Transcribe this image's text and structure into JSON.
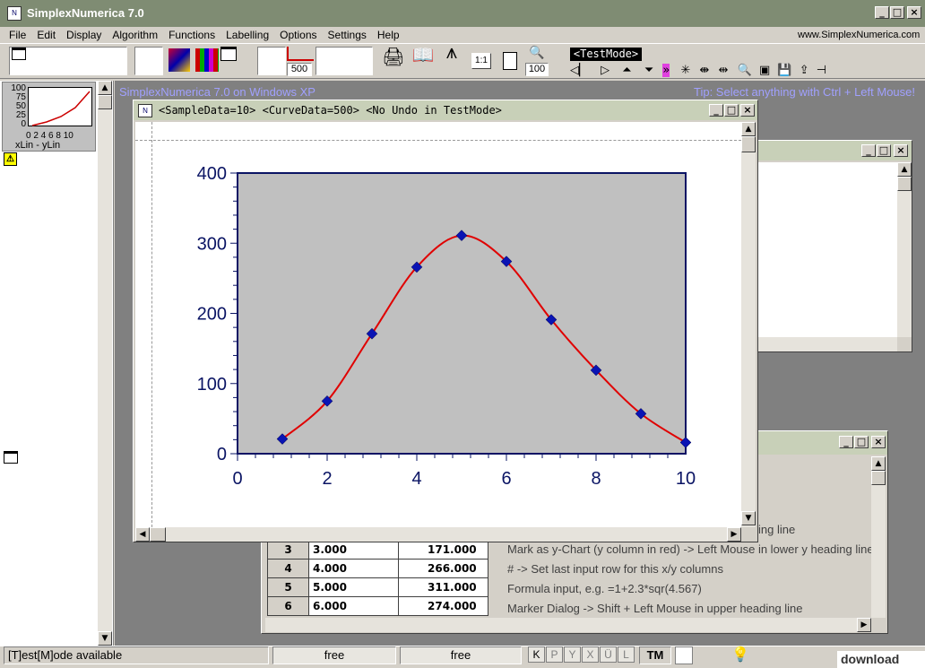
{
  "app": {
    "title": "SimplexNumerica 7.0",
    "url": "www.SimplexNumerica.com"
  },
  "menu": [
    "File",
    "Edit",
    "Display",
    "Algorithm",
    "Functions",
    "Labelling",
    "Options",
    "Settings",
    "Help"
  ],
  "toolbar": {
    "curve_points": "500",
    "zoom": "100",
    "ratio": "1:1",
    "mode_badge": "<TestMode>"
  },
  "thumbnail": {
    "ticks_y": [
      "100",
      "75",
      "50",
      "25",
      "0"
    ],
    "ticks_x": "0 2 4 6 8 10",
    "caption": "xLin - yLin"
  },
  "mdi_bg": {
    "left_text": "SimplexNumerica 7.0 on Windows XP",
    "right_text": "Tip: Select anything with Ctrl + Left Mouse!"
  },
  "chart_window": {
    "title": "<SampleData=10> <CurveData=500> <No Undo in TestMode>"
  },
  "chart_data": {
    "type": "line",
    "x": [
      1,
      2,
      3,
      4,
      5,
      6,
      7,
      8,
      9,
      10
    ],
    "y": [
      21,
      75,
      171,
      266,
      311,
      274,
      191,
      119,
      57,
      16
    ],
    "xlim": [
      0,
      10
    ],
    "ylim": [
      0,
      400
    ],
    "xticks": [
      "0",
      "2",
      "4",
      "6",
      "8",
      "10"
    ],
    "yticks": [
      "0",
      "100",
      "200",
      "300",
      "400"
    ],
    "title": "",
    "xlabel": "",
    "ylabel": "",
    "curve_color": "#e00000",
    "marker_color": "#0a14b4",
    "plot_bg": "#c0c0c0",
    "axis_color": "#0a1464"
  },
  "table": {
    "rows": [
      {
        "n": "3",
        "x": "3.000",
        "y": "171.000"
      },
      {
        "n": "4",
        "x": "4.000",
        "y": "266.000"
      },
      {
        "n": "5",
        "x": "5.000",
        "y": "311.000"
      },
      {
        "n": "6",
        "x": "6.000",
        "y": "274.000"
      }
    ],
    "help_lines": [
      "ing line",
      "Mark as y-Chart (y column in red) -> Left Mouse in lower y heading line",
      "# -> Set last input row for this x/y columns",
      "Formula input, e.g. =1+2.3*sqr(4.567)",
      "Marker Dialog -> Shift + Left Mouse in upper heading line"
    ]
  },
  "status": {
    "message": "[T]est[M]ode available",
    "slot1": "free",
    "slot2": "free",
    "keys": [
      "K",
      "P",
      "Y",
      "X",
      "Ü",
      "L"
    ],
    "tm": "TM",
    "watermark": "download"
  }
}
